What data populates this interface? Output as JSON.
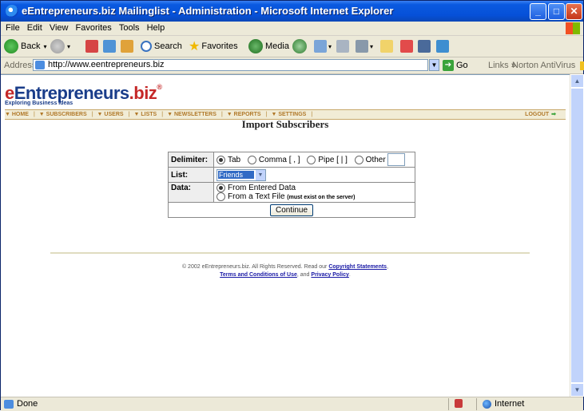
{
  "window": {
    "title": "eEntrepreneurs.biz Mailinglist - Administration - Microsoft Internet Explorer"
  },
  "menu": [
    "File",
    "Edit",
    "View",
    "Favorites",
    "Tools",
    "Help"
  ],
  "toolbar": {
    "back": "Back",
    "search": "Search",
    "favorites": "Favorites",
    "media": "Media"
  },
  "address": {
    "label": "Address",
    "url": "http://www.eentrepreneurs.biz",
    "go": "Go",
    "links": "Links",
    "links_chevron": "»",
    "norton": "Norton AntiVirus"
  },
  "site": {
    "logo_e": "e",
    "logo_main": "Entrepreneurs",
    "logo_biz": ".biz",
    "logo_reg": "®",
    "tagline": "Exploring Business Ideas",
    "nav": [
      "HOME",
      "SUBSCRIBERS",
      "USERS",
      "LISTS",
      "NEWSLETTERS",
      "REPORTS",
      "SETTINGS"
    ],
    "logout": "LOGOUT"
  },
  "page": {
    "heading": "Import Subscribers"
  },
  "form": {
    "delimiter_label": "Delimiter:",
    "delim_tab": "Tab",
    "delim_comma": "Comma [ , ]",
    "delim_pipe": "Pipe [ | ]",
    "delim_other": "Other",
    "list_label": "List:",
    "list_value": "Friends",
    "data_label": "Data:",
    "data_entered": "From Entered Data",
    "data_file": "From a Text File",
    "data_file_note": "(must exist on the server)",
    "continue": "Continue"
  },
  "footer": {
    "line1_prefix": "© 2002 eEntrepreneurs.biz. All Rights Reserved. Read our",
    "copyright_link": "Copyright Statements",
    "line1_suffix": ",",
    "terms_link": "Terms and Conditions of Use",
    "and": ", and",
    "privacy_link": "Privacy Policy",
    "end": "."
  },
  "status": {
    "done": "Done",
    "zone": "Internet"
  }
}
